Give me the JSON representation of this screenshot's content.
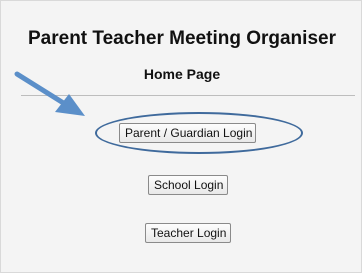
{
  "header": {
    "app_title": "Parent Teacher Meeting Organiser",
    "page_heading": "Home Page"
  },
  "login_buttons": {
    "parent_guardian": "Parent / Guardian Login",
    "school": "School Login",
    "teacher": "Teacher Login"
  },
  "annotation": {
    "arrow_icon": "arrow-icon",
    "highlight_color": "#3f6a9c",
    "arrow_color": "#5b8fc9"
  }
}
